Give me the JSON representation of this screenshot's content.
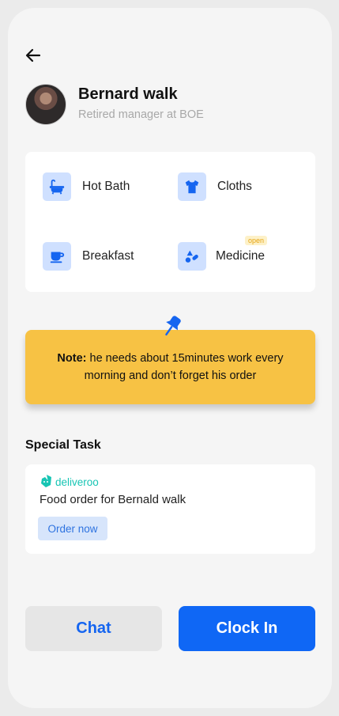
{
  "header": {
    "back_icon": "arrow-left-icon"
  },
  "profile": {
    "name": "Bernard walk",
    "role": "Retired manager at BOE"
  },
  "services": [
    {
      "label": "Hot Bath",
      "icon": "bathtub-icon"
    },
    {
      "label": "Cloths",
      "icon": "shirt-icon"
    },
    {
      "label": "Breakfast",
      "icon": "cup-icon"
    },
    {
      "label": "Medicine",
      "icon": "pills-icon",
      "badge": "open"
    }
  ],
  "note": {
    "prefix": "Note:",
    "text": " he needs about 15minutes work every morning and don’t forget his order",
    "icon": "pushpin-icon"
  },
  "special_task": {
    "title": "Special Task",
    "brand": "deliveroo",
    "description": "Food order for Bernald walk",
    "action_label": "Order now"
  },
  "actions": {
    "chat_label": "Chat",
    "clock_in_label": "Clock In"
  },
  "colors": {
    "primary": "#0f67f5",
    "note_bg": "#f7c244",
    "icon_bg": "#cfe0ff",
    "deliveroo": "#18c5b4"
  }
}
